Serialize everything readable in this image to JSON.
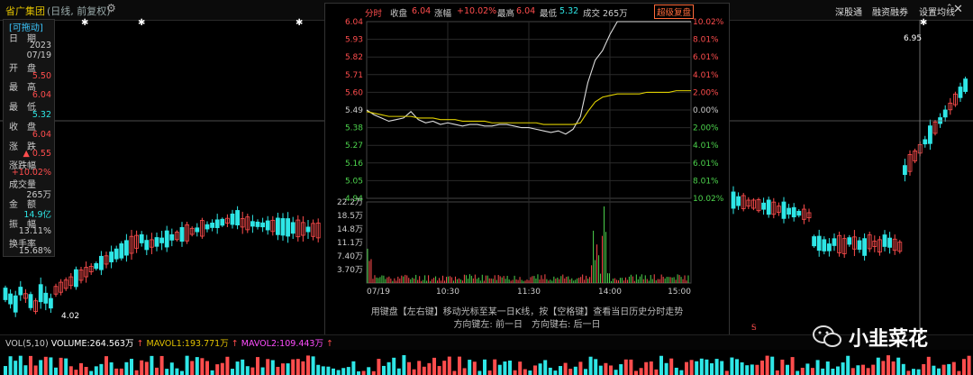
{
  "header": {
    "stock_name": "省广集团",
    "stock_sub": "(日线, 前复权)",
    "buttons": [
      "深股通",
      "融资融券",
      "设置均线"
    ],
    "gear_icon": "gear-icon",
    "close_icon": "close-icon"
  },
  "info_panel": {
    "title": "[可拖动]",
    "rows": [
      {
        "label": "日　期",
        "value": "2023",
        "value2": "07/19",
        "color": "#cccccc"
      },
      {
        "label": "开　盘",
        "value": "5.50",
        "color": "#ff4d4d"
      },
      {
        "label": "最　高",
        "value": "6.04",
        "color": "#ff4d4d"
      },
      {
        "label": "最　低",
        "value": "5.32",
        "color": "#2ee6e6"
      },
      {
        "label": "收　盘",
        "value": "6.04",
        "color": "#ff4d4d"
      },
      {
        "label": "涨　跌",
        "value": "▲ 0.55",
        "color": "#ff4d4d"
      },
      {
        "label": "涨跌幅",
        "value": "+10.02%",
        "color": "#ff4d4d"
      },
      {
        "label": "成交量",
        "value": "265万",
        "color": "#cccccc"
      },
      {
        "label": "金　额",
        "value": "14.9亿",
        "color": "#2ee6e6"
      },
      {
        "label": "振　幅",
        "value": "13.11%",
        "color": "#cccccc"
      },
      {
        "label": "换手率",
        "value": "15.68%",
        "color": "#cccccc"
      }
    ]
  },
  "kline": {
    "price_labels": [
      {
        "text": "6.95",
        "note": "high marker"
      },
      {
        "text": "4.02",
        "note": "low marker"
      }
    ]
  },
  "timeshare": {
    "header": {
      "title": "分时",
      "prev_close_label": "收盘",
      "prev_close": "6.04",
      "change_label": "涨幅",
      "change": "+10.02%",
      "high_label": "最高",
      "high": "6.04",
      "low_label": "最低",
      "low": "5.32",
      "volume_label": "成交",
      "volume": "265万",
      "button": "超级复盘"
    },
    "price_ticks": [
      "6.04",
      "5.93",
      "5.82",
      "5.71",
      "5.60",
      "5.49",
      "5.38",
      "5.27",
      "5.16",
      "5.05",
      "4.94"
    ],
    "pct_ticks": [
      "10.02%",
      "8.01%",
      "6.01%",
      "4.01%",
      "2.00%",
      "0.00%",
      "2.00%",
      "4.01%",
      "6.01%",
      "8.01%",
      "10.02%"
    ],
    "vol_ticks": [
      "22.2万",
      "18.5万",
      "14.8万",
      "11.1万",
      "7.40万",
      "3.70万"
    ],
    "time_ticks": [
      "07/19",
      "10:30",
      "11:30",
      "14:00",
      "15:00"
    ],
    "hint1": "用键盘【左右键】移动光标至某一日K线，按【空格键】查看当日历史分时走势",
    "hint2": "方向键左: 前一日　方向键右: 后一日",
    "chart_data": {
      "type": "line",
      "y_range": [
        4.94,
        6.04
      ],
      "series": [
        {
          "values": [
            5.49,
            5.46,
            5.44,
            5.42,
            5.43,
            5.44,
            5.48,
            5.43,
            5.41,
            5.42,
            5.4,
            5.41,
            5.4,
            5.39,
            5.4,
            5.4,
            5.39,
            5.39,
            5.4,
            5.4,
            5.39,
            5.38,
            5.38,
            5.37,
            5.36,
            5.35,
            5.36,
            5.34,
            5.37,
            5.45,
            5.66,
            5.8,
            5.86,
            5.96,
            6.04,
            6.04,
            6.04,
            6.04,
            6.04,
            6.04,
            6.04,
            6.04,
            6.04,
            6.04,
            6.04
          ]
        },
        {
          "values": [
            5.48,
            5.47,
            5.46,
            5.45,
            5.45,
            5.45,
            5.45,
            5.44,
            5.44,
            5.44,
            5.43,
            5.43,
            5.43,
            5.42,
            5.42,
            5.42,
            5.42,
            5.41,
            5.41,
            5.41,
            5.41,
            5.41,
            5.41,
            5.41,
            5.4,
            5.4,
            5.4,
            5.4,
            5.4,
            5.41,
            5.48,
            5.54,
            5.57,
            5.58,
            5.59,
            5.59,
            5.59,
            5.59,
            5.6,
            5.6,
            5.6,
            5.6,
            5.61,
            5.61,
            5.61
          ]
        }
      ]
    }
  },
  "volume_strip": {
    "label": "VOL(5,10)",
    "volume": "VOLUME:264.563万",
    "mavol1": "MAVOL1:193.771万",
    "mavol2": "MAVOL2:109.443万"
  },
  "watermark": {
    "text": "小韭菜花",
    "icon": "wechat-icon"
  },
  "colors": {
    "up": "#ff4d4d",
    "down": "#2ee6e6",
    "accent": "#e0c000"
  }
}
